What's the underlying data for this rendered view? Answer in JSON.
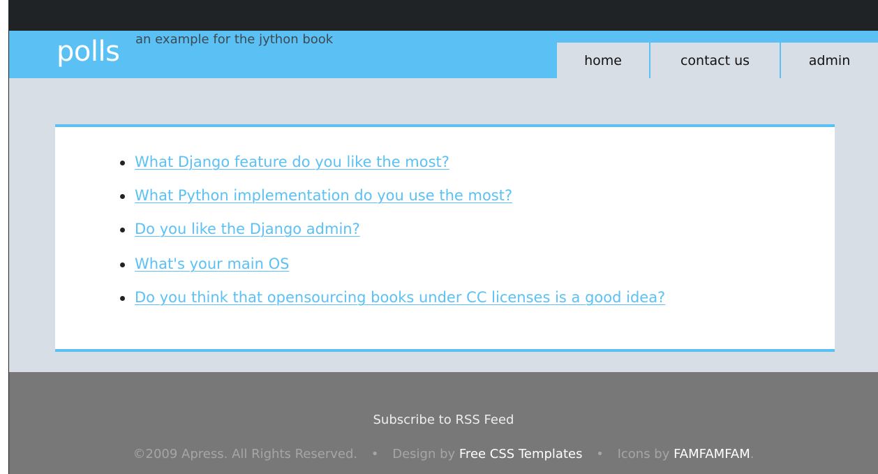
{
  "header": {
    "logo": "polls",
    "tagline": "an example for the jython book"
  },
  "nav": {
    "home": "home",
    "contact": "contact us",
    "admin": "admin"
  },
  "polls": [
    "What Django feature do you like the most?",
    "What Python implementation do you use the most?",
    "Do you like the Django admin?",
    "What's your main OS",
    "Do you think that opensourcing books under CC licenses is a good idea?"
  ],
  "footer": {
    "rss": "Subscribe to RSS Feed",
    "copyright": "©2009 Apress. All Rights Reserved.",
    "separator": "•",
    "design_prefix": "Design by",
    "design_link": "Free CSS Templates",
    "icons_prefix": "Icons by",
    "icons_link": "FAMFAMFAM",
    "icons_suffix": "."
  },
  "colors": {
    "accent": "#5bc1f5",
    "background": "#d8dee6",
    "topbar": "#1f2326",
    "footer": "#787878"
  }
}
